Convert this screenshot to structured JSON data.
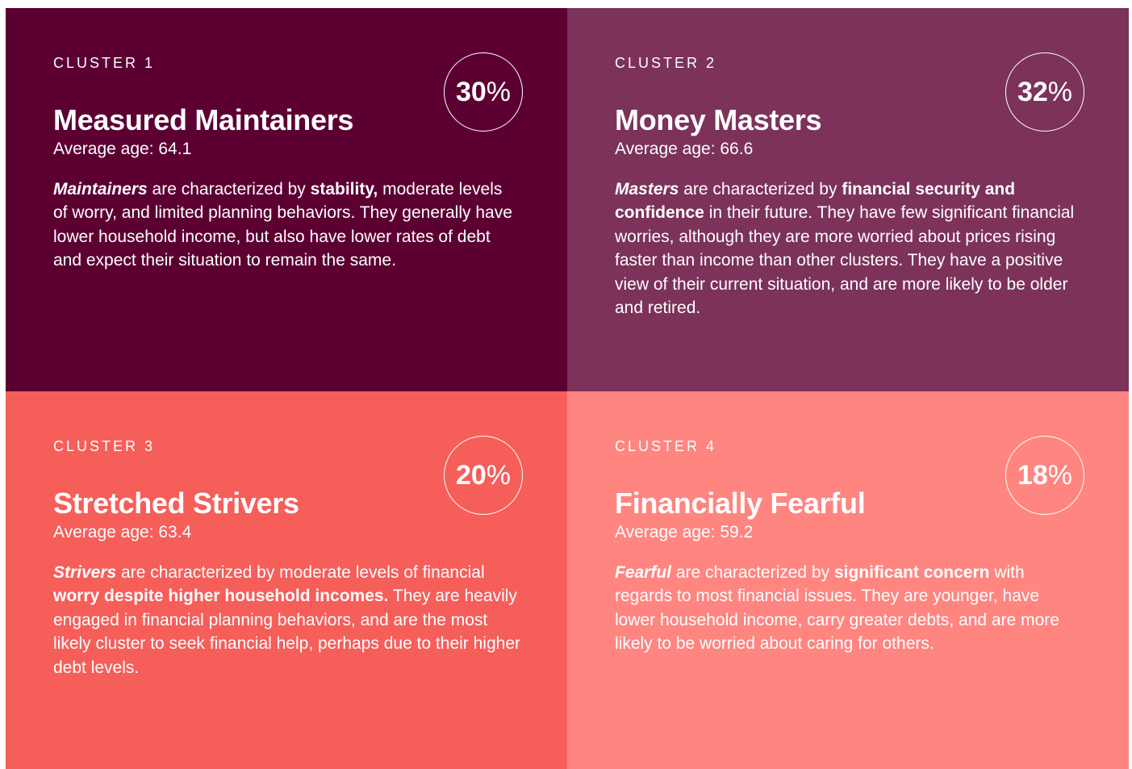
{
  "clusters": [
    {
      "label": "CLUSTER 1",
      "percent_number": "30",
      "percent_sign": "%",
      "title": "Measured Maintainers",
      "age": "Average age: 64.1",
      "desc_segments": [
        {
          "text": "Maintainers",
          "style": "lead"
        },
        {
          "text": " are characterized by ",
          "style": ""
        },
        {
          "text": "stability,",
          "style": "bold"
        },
        {
          "text": " moderate levels of worry, and limited planning behaviors. They generally have lower household income, but also have lower rates of debt and expect their situation to remain the same.",
          "style": ""
        }
      ]
    },
    {
      "label": "CLUSTER 2",
      "percent_number": "32",
      "percent_sign": "%",
      "title": "Money Masters",
      "age": "Average age: 66.6",
      "desc_segments": [
        {
          "text": "Masters",
          "style": "lead"
        },
        {
          "text": " are characterized by ",
          "style": ""
        },
        {
          "text": "financial security and confidence",
          "style": "bold"
        },
        {
          "text": " in their future. They have few significant financial worries, although they are more worried about prices rising faster than income than other clusters. They have a positive view of their current situation, and are more likely to be older and retired.",
          "style": ""
        }
      ]
    },
    {
      "label": "CLUSTER 3",
      "percent_number": "20",
      "percent_sign": "%",
      "title": "Stretched Strivers",
      "age": "Average age: 63.4",
      "desc_segments": [
        {
          "text": "Strivers",
          "style": "lead"
        },
        {
          "text": " are characterized by moderate levels of financial ",
          "style": ""
        },
        {
          "text": "worry despite higher household incomes.",
          "style": "bold"
        },
        {
          "text": " They are heavily engaged in financial planning behaviors, and are the most likely cluster to seek financial help, perhaps due to their higher debt levels.",
          "style": ""
        }
      ]
    },
    {
      "label": "CLUSTER 4",
      "percent_number": "18",
      "percent_sign": "%",
      "title": "Financially Fearful",
      "age": "Average age: 59.2",
      "desc_segments": [
        {
          "text": "Fearful",
          "style": "lead"
        },
        {
          "text": " are characterized by ",
          "style": ""
        },
        {
          "text": "significant concern",
          "style": "bold"
        },
        {
          "text": " with regards to most financial issues. They are younger, have lower household income, carry greater debts, and are more likely to be worried about caring for others.",
          "style": ""
        }
      ]
    }
  ],
  "colors": {
    "cluster1_bg": "#5c0032",
    "cluster2_bg": "#7c3259",
    "cluster3_bg": "#f65e5a",
    "cluster4_bg": "#ff8580",
    "text": "#ffffff"
  }
}
